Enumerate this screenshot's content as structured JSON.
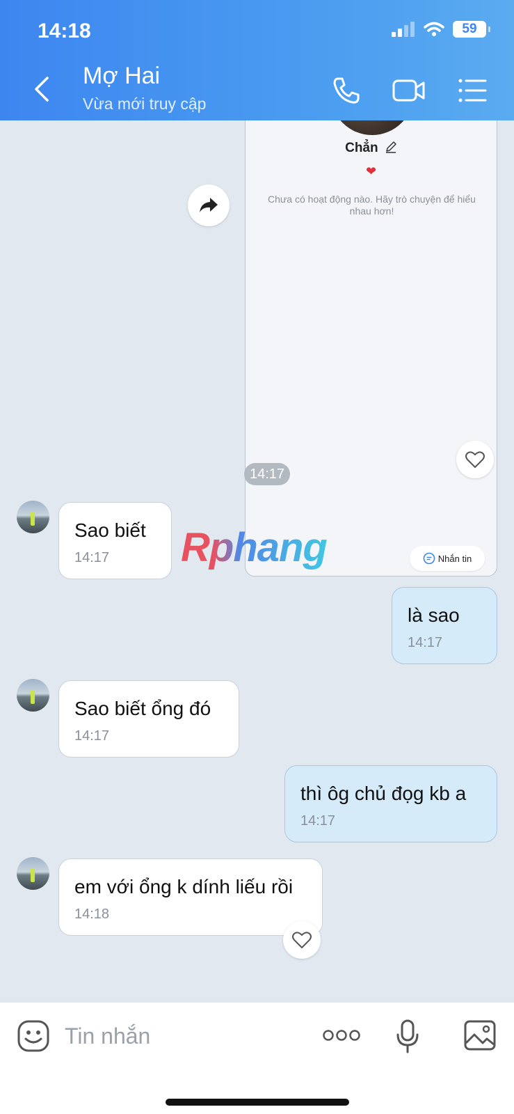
{
  "status_bar": {
    "time": "14:18",
    "battery": "59"
  },
  "header": {
    "name": "Mợ Hai",
    "status": "Vừa mới truy cập"
  },
  "profile_card": {
    "name": "Chẳn",
    "heart": "❤",
    "empty_text": "Chưa có hoạt động nào. Hãy trò chuyện để hiểu nhau hơn!",
    "message_button": "Nhắn tin"
  },
  "separator_time": "14:17",
  "messages": [
    {
      "direction": "in",
      "text": "Sao biết",
      "time": "14:17"
    },
    {
      "direction": "out",
      "text": "là sao",
      "time": "14:17"
    },
    {
      "direction": "in",
      "text": "Sao biết ổng đó",
      "time": "14:17"
    },
    {
      "direction": "out",
      "text": "thì ôg chủ đọg kb a",
      "time": "14:17"
    },
    {
      "direction": "in",
      "text": "em với ổng k dính liếu rồi",
      "time": "14:18"
    }
  ],
  "watermark": "Rphang",
  "input": {
    "placeholder": "Tin nhắn"
  },
  "colors": {
    "header": "#4a9cf0",
    "outgoing_bubble": "#d6ebfa",
    "chat_background": "#e2e8f0"
  }
}
